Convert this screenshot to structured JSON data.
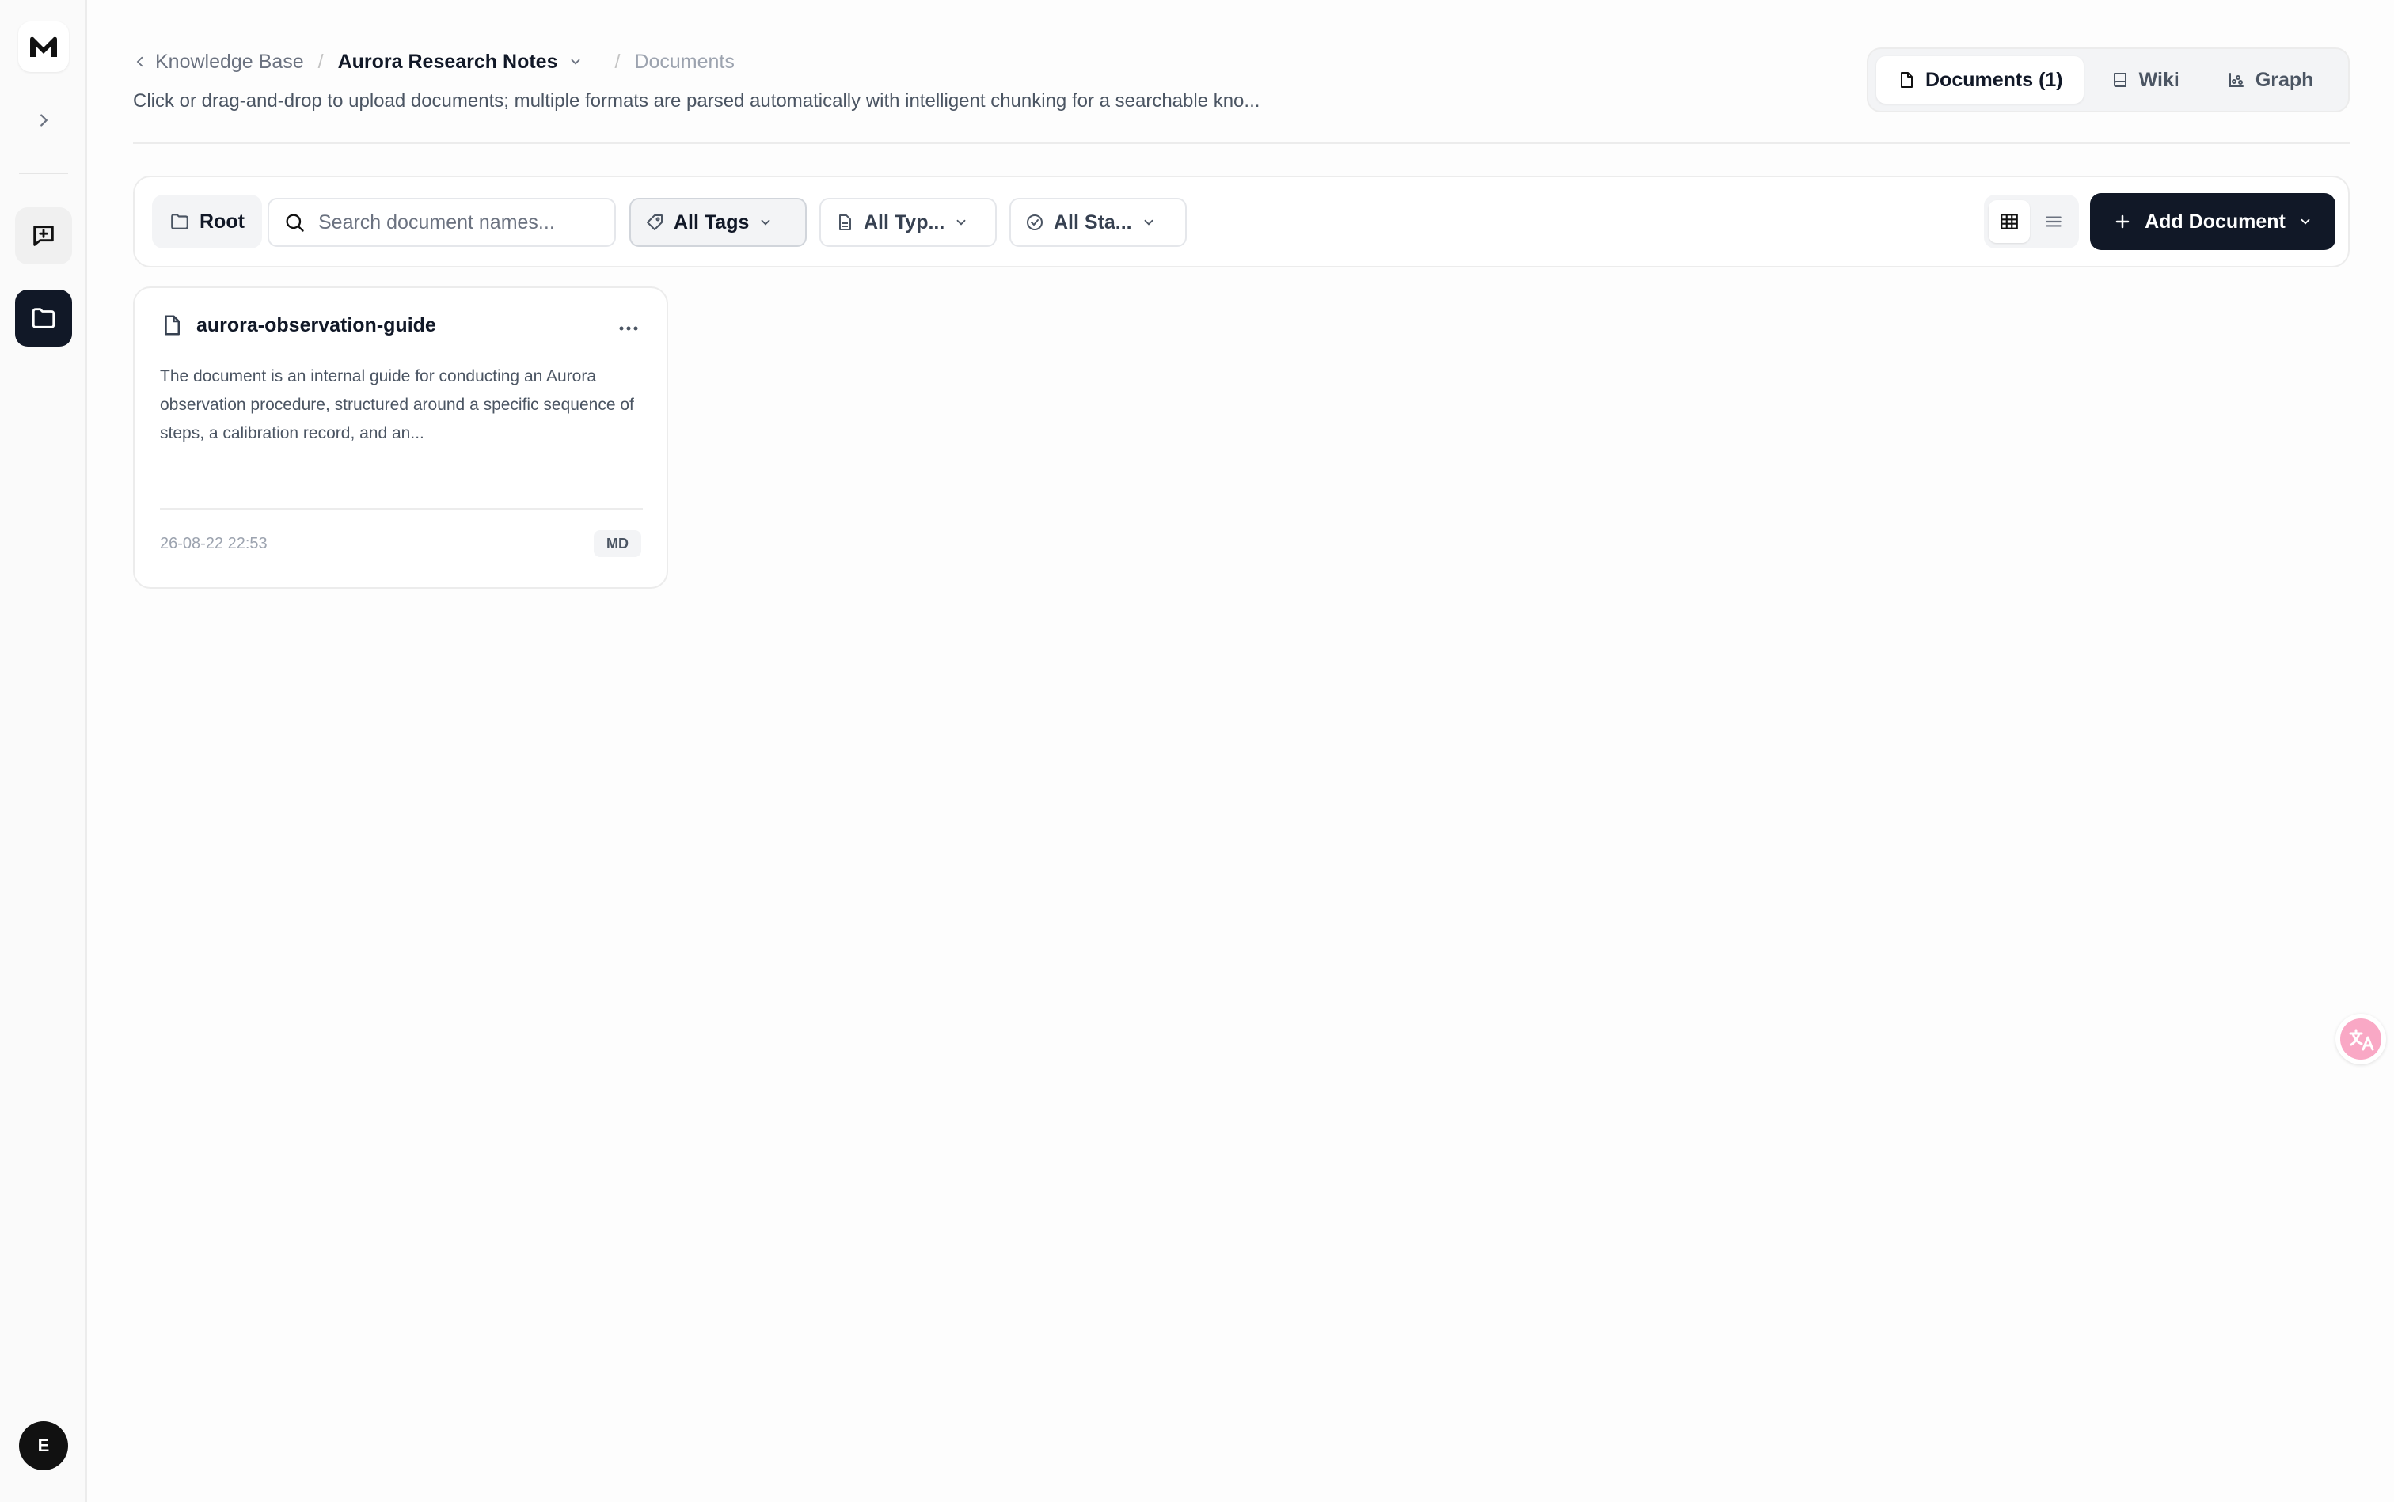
{
  "sidebar": {
    "logo_icon": "m-logo-icon",
    "avatar_initial": "E"
  },
  "breadcrumb": {
    "back_label": "Knowledge Base",
    "knowledge_base_name": "Aurora Research Notes",
    "current": "Documents",
    "separator": "/"
  },
  "subtitle": "Click or drag-and-drop to upload documents; multiple formats are parsed automatically with intelligent chunking for a searchable kno...",
  "view_tabs": [
    {
      "label": "Documents (1)",
      "icon": "document-icon",
      "active": true
    },
    {
      "label": "Wiki",
      "icon": "book-icon",
      "active": false
    },
    {
      "label": "Graph",
      "icon": "graph-icon",
      "active": false
    }
  ],
  "toolbar": {
    "root_label": "Root",
    "search_placeholder": "Search document names...",
    "tags_label": "All Tags",
    "types_label": "All Typ...",
    "status_label": "All Sta...",
    "add_document_label": "Add Document"
  },
  "documents": [
    {
      "title": "aurora-observation-guide",
      "description": "The document is an internal guide for conducting an Aurora observation procedure, structured around a specific sequence of steps, a calibration record, and an...",
      "date": "26-08-22 22:53",
      "format": "MD"
    }
  ],
  "colors": {
    "primary_dark": "#111827",
    "border": "#ececec",
    "muted_text": "#6b7280",
    "translate_accent": "#f472b6"
  }
}
